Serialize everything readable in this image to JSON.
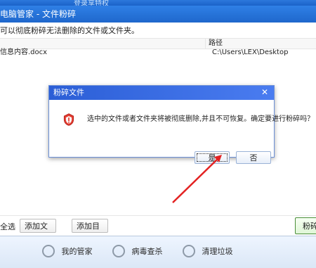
{
  "window": {
    "top_hint": "登录享特权",
    "title": "电脑管家 - 文件粉碎",
    "description": "可以彻底粉碎无法删除的文件或文件夹。",
    "columns": {
      "left": "",
      "path": "路径"
    },
    "row": {
      "name": "信息内容.docx",
      "path": "C:\\Users\\LEX\\Desktop"
    },
    "bottom": {
      "select_all": "全选",
      "add_file": "添加文件...",
      "add_folder": "添加目录...",
      "shred": "粉碎"
    }
  },
  "feature_bar": {
    "items": [
      {
        "label": "我的管家",
        "icon": "manager-icon"
      },
      {
        "label": "病毒查杀",
        "icon": "virus-scan-icon"
      },
      {
        "label": "清理垃圾",
        "icon": "cleanup-icon"
      }
    ]
  },
  "dialog": {
    "title": "粉碎文件",
    "close_glyph": "✕",
    "message": "选中的文件或者文件夹将被彻底删除,并且不可恢复。确定要进行粉碎吗？",
    "yes": "是",
    "no": "否",
    "warning_icon": "warning-shield-icon"
  },
  "colors": {
    "accent_blue": "#2b5ed6",
    "arrow_red": "#e32222"
  }
}
